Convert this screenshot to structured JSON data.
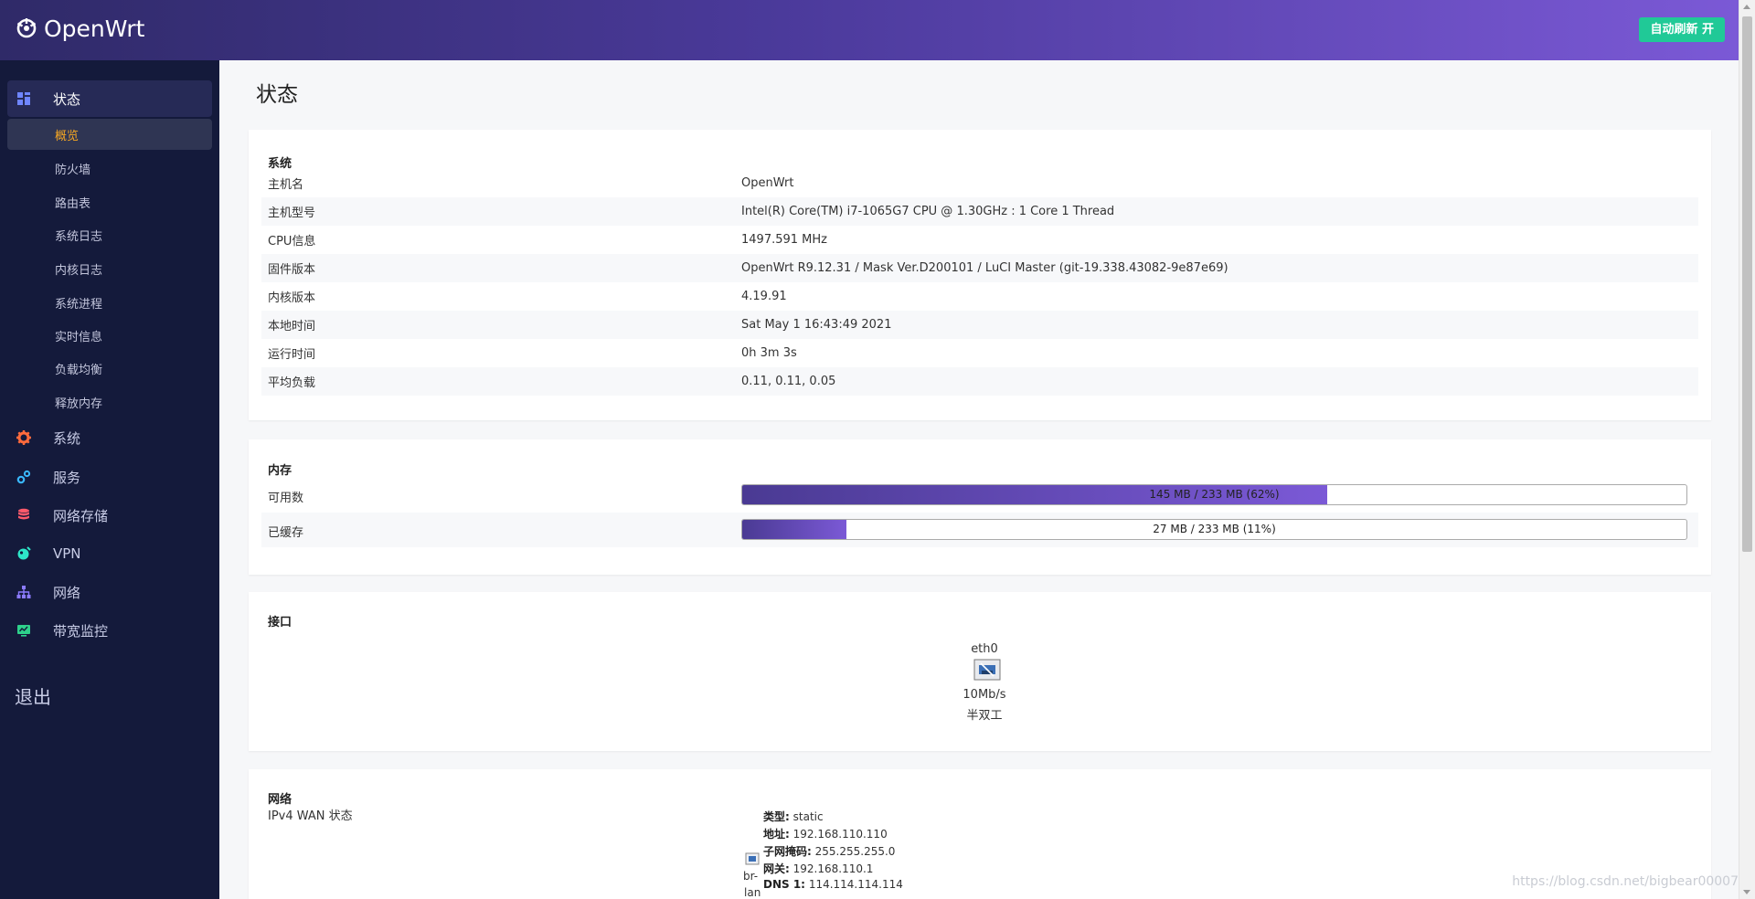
{
  "header": {
    "brand": "OpenWrt",
    "auto_refresh": "自动刷新 开"
  },
  "sidebar": {
    "groups": [
      {
        "label": "状态",
        "icon": "dashboard-icon",
        "color": "#6f86ff"
      },
      {
        "label": "系统",
        "icon": "gear-icon",
        "color": "#ff6b3d"
      },
      {
        "label": "服务",
        "icon": "cogs-icon",
        "color": "#3ab8ff"
      },
      {
        "label": "网络存储",
        "icon": "database-icon",
        "color": "#ff5a6b"
      },
      {
        "label": "VPN",
        "icon": "globe-icon",
        "color": "#2ee6c8"
      },
      {
        "label": "网络",
        "icon": "sitemap-icon",
        "color": "#8b7bff"
      },
      {
        "label": "带宽监控",
        "icon": "monitor-icon",
        "color": "#2ed18b"
      }
    ],
    "status_items": [
      "概览",
      "防火墙",
      "路由表",
      "系统日志",
      "内核日志",
      "系统进程",
      "实时信息",
      "负载均衡",
      "释放内存"
    ],
    "logout": "退出"
  },
  "main": {
    "title": "状态",
    "system": {
      "title": "系统",
      "rows": [
        {
          "label": "主机名",
          "value": "OpenWrt"
        },
        {
          "label": "主机型号",
          "value": "Intel(R) Core(TM) i7-1065G7 CPU @ 1.30GHz : 1 Core 1 Thread"
        },
        {
          "label": "CPU信息",
          "value": "1497.591 MHz"
        },
        {
          "label": "固件版本",
          "value": "OpenWrt R9.12.31 / Mask Ver.D200101 / LuCI Master (git-19.338.43082-9e87e69)"
        },
        {
          "label": "内核版本",
          "value": "4.19.91"
        },
        {
          "label": "本地时间",
          "value": "Sat May 1 16:43:49 2021"
        },
        {
          "label": "运行时间",
          "value": "0h 3m 3s"
        },
        {
          "label": "平均负载",
          "value": "0.11, 0.11, 0.05"
        }
      ]
    },
    "memory": {
      "title": "内存",
      "rows": [
        {
          "label": "可用数",
          "text": "145 MB / 233 MB (62%)",
          "percent": 62
        },
        {
          "label": "已缓存",
          "text": "27 MB / 233 MB (11%)",
          "percent": 11
        }
      ]
    },
    "interfaces": {
      "title": "接口",
      "name": "eth0",
      "speed": "10Mb/s",
      "duplex": "半双工"
    },
    "network": {
      "title": "网络",
      "wan_label": "IPv4 WAN 状态",
      "iface_label_1": "br-",
      "iface_label_2": "lan",
      "details": [
        {
          "key": "类型:",
          "value": "static"
        },
        {
          "key": "地址:",
          "value": "192.168.110.110"
        },
        {
          "key": "子网掩码:",
          "value": "255.255.255.0"
        },
        {
          "key": "网关:",
          "value": "192.168.110.1"
        },
        {
          "key": "DNS 1:",
          "value": "114.114.114.114"
        }
      ]
    }
  },
  "watermark": "https://blog.csdn.net/bigbear00007"
}
